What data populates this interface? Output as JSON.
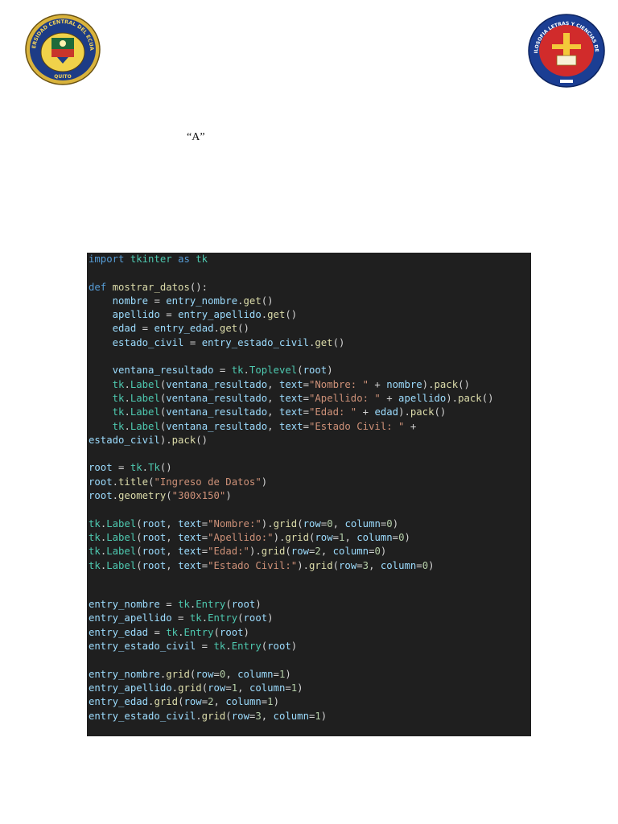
{
  "header": {
    "left_logo": "universidad-central-del-ecuador-seal",
    "right_logo": "facultad-de-filosofia-letras-y-ciencias-de-la-educacion-seal",
    "left_logo_text": "UNIVERSIDAD CENTRAL DEL ECUADOR",
    "left_logo_city": "QUITO",
    "right_logo_text": "FACULTAD DE FILOSOFIA LETRAS Y CIENCIAS DE LA EDUCACION"
  },
  "section_label": "“A”",
  "code": {
    "language": "python",
    "lines": [
      [
        [
          "kw",
          "import"
        ],
        [
          "plain",
          " "
        ],
        [
          "mod",
          "tkinter"
        ],
        [
          "plain",
          " "
        ],
        [
          "kw",
          "as"
        ],
        [
          "plain",
          " "
        ],
        [
          "mod",
          "tk"
        ]
      ],
      [],
      [
        [
          "kw",
          "def"
        ],
        [
          "plain",
          " "
        ],
        [
          "fn",
          "mostrar_datos"
        ],
        [
          "plain",
          "():"
        ]
      ],
      [
        [
          "plain",
          "    "
        ],
        [
          "var",
          "nombre"
        ],
        [
          "plain",
          " = "
        ],
        [
          "var",
          "entry_nombre"
        ],
        [
          "plain",
          "."
        ],
        [
          "fn",
          "get"
        ],
        [
          "plain",
          "()"
        ]
      ],
      [
        [
          "plain",
          "    "
        ],
        [
          "var",
          "apellido"
        ],
        [
          "plain",
          " = "
        ],
        [
          "var",
          "entry_apellido"
        ],
        [
          "plain",
          "."
        ],
        [
          "fn",
          "get"
        ],
        [
          "plain",
          "()"
        ]
      ],
      [
        [
          "plain",
          "    "
        ],
        [
          "var",
          "edad"
        ],
        [
          "plain",
          " = "
        ],
        [
          "var",
          "entry_edad"
        ],
        [
          "plain",
          "."
        ],
        [
          "fn",
          "get"
        ],
        [
          "plain",
          "()"
        ]
      ],
      [
        [
          "plain",
          "    "
        ],
        [
          "var",
          "estado_civil"
        ],
        [
          "plain",
          " = "
        ],
        [
          "var",
          "entry_estado_civil"
        ],
        [
          "plain",
          "."
        ],
        [
          "fn",
          "get"
        ],
        [
          "plain",
          "()"
        ]
      ],
      [],
      [
        [
          "plain",
          "    "
        ],
        [
          "var",
          "ventana_resultado"
        ],
        [
          "plain",
          " = "
        ],
        [
          "mod",
          "tk"
        ],
        [
          "plain",
          "."
        ],
        [
          "mod",
          "Toplevel"
        ],
        [
          "plain",
          "("
        ],
        [
          "var",
          "root"
        ],
        [
          "plain",
          ")"
        ]
      ],
      [
        [
          "plain",
          "    "
        ],
        [
          "mod",
          "tk"
        ],
        [
          "plain",
          "."
        ],
        [
          "mod",
          "Label"
        ],
        [
          "plain",
          "("
        ],
        [
          "var",
          "ventana_resultado"
        ],
        [
          "plain",
          ", "
        ],
        [
          "var",
          "text"
        ],
        [
          "plain",
          "="
        ],
        [
          "str",
          "\"Nombre: \""
        ],
        [
          "plain",
          " + "
        ],
        [
          "var",
          "nombre"
        ],
        [
          "plain",
          ")."
        ],
        [
          "fn",
          "pack"
        ],
        [
          "plain",
          "()"
        ]
      ],
      [
        [
          "plain",
          "    "
        ],
        [
          "mod",
          "tk"
        ],
        [
          "plain",
          "."
        ],
        [
          "mod",
          "Label"
        ],
        [
          "plain",
          "("
        ],
        [
          "var",
          "ventana_resultado"
        ],
        [
          "plain",
          ", "
        ],
        [
          "var",
          "text"
        ],
        [
          "plain",
          "="
        ],
        [
          "str",
          "\"Apellido: \""
        ],
        [
          "plain",
          " + "
        ],
        [
          "var",
          "apellido"
        ],
        [
          "plain",
          ")."
        ],
        [
          "fn",
          "pack"
        ],
        [
          "plain",
          "()"
        ]
      ],
      [
        [
          "plain",
          "    "
        ],
        [
          "mod",
          "tk"
        ],
        [
          "plain",
          "."
        ],
        [
          "mod",
          "Label"
        ],
        [
          "plain",
          "("
        ],
        [
          "var",
          "ventana_resultado"
        ],
        [
          "plain",
          ", "
        ],
        [
          "var",
          "text"
        ],
        [
          "plain",
          "="
        ],
        [
          "str",
          "\"Edad: \""
        ],
        [
          "plain",
          " + "
        ],
        [
          "var",
          "edad"
        ],
        [
          "plain",
          ")."
        ],
        [
          "fn",
          "pack"
        ],
        [
          "plain",
          "()"
        ]
      ],
      [
        [
          "plain",
          "    "
        ],
        [
          "mod",
          "tk"
        ],
        [
          "plain",
          "."
        ],
        [
          "mod",
          "Label"
        ],
        [
          "plain",
          "("
        ],
        [
          "var",
          "ventana_resultado"
        ],
        [
          "plain",
          ", "
        ],
        [
          "var",
          "text"
        ],
        [
          "plain",
          "="
        ],
        [
          "str",
          "\"Estado Civil: \""
        ],
        [
          "plain",
          " +"
        ]
      ],
      [
        [
          "var",
          "estado_civil"
        ],
        [
          "plain",
          ")."
        ],
        [
          "fn",
          "pack"
        ],
        [
          "plain",
          "()"
        ]
      ],
      [],
      [
        [
          "var",
          "root"
        ],
        [
          "plain",
          " = "
        ],
        [
          "mod",
          "tk"
        ],
        [
          "plain",
          "."
        ],
        [
          "mod",
          "Tk"
        ],
        [
          "plain",
          "()"
        ]
      ],
      [
        [
          "var",
          "root"
        ],
        [
          "plain",
          "."
        ],
        [
          "fn",
          "title"
        ],
        [
          "plain",
          "("
        ],
        [
          "str",
          "\"Ingreso de Datos\""
        ],
        [
          "plain",
          ")"
        ]
      ],
      [
        [
          "var",
          "root"
        ],
        [
          "plain",
          "."
        ],
        [
          "fn",
          "geometry"
        ],
        [
          "plain",
          "("
        ],
        [
          "str",
          "\"300x150\""
        ],
        [
          "plain",
          ")"
        ]
      ],
      [],
      [
        [
          "mod",
          "tk"
        ],
        [
          "plain",
          "."
        ],
        [
          "mod",
          "Label"
        ],
        [
          "plain",
          "("
        ],
        [
          "var",
          "root"
        ],
        [
          "plain",
          ", "
        ],
        [
          "var",
          "text"
        ],
        [
          "plain",
          "="
        ],
        [
          "str",
          "\"Nombre:\""
        ],
        [
          "plain",
          ")."
        ],
        [
          "fn",
          "grid"
        ],
        [
          "plain",
          "("
        ],
        [
          "var",
          "row"
        ],
        [
          "plain",
          "="
        ],
        [
          "num",
          "0"
        ],
        [
          "plain",
          ", "
        ],
        [
          "var",
          "column"
        ],
        [
          "plain",
          "="
        ],
        [
          "num",
          "0"
        ],
        [
          "plain",
          ")"
        ]
      ],
      [
        [
          "mod",
          "tk"
        ],
        [
          "plain",
          "."
        ],
        [
          "mod",
          "Label"
        ],
        [
          "plain",
          "("
        ],
        [
          "var",
          "root"
        ],
        [
          "plain",
          ", "
        ],
        [
          "var",
          "text"
        ],
        [
          "plain",
          "="
        ],
        [
          "str",
          "\"Apellido:\""
        ],
        [
          "plain",
          ")."
        ],
        [
          "fn",
          "grid"
        ],
        [
          "plain",
          "("
        ],
        [
          "var",
          "row"
        ],
        [
          "plain",
          "="
        ],
        [
          "num",
          "1"
        ],
        [
          "plain",
          ", "
        ],
        [
          "var",
          "column"
        ],
        [
          "plain",
          "="
        ],
        [
          "num",
          "0"
        ],
        [
          "plain",
          ")"
        ]
      ],
      [
        [
          "mod",
          "tk"
        ],
        [
          "plain",
          "."
        ],
        [
          "mod",
          "Label"
        ],
        [
          "plain",
          "("
        ],
        [
          "var",
          "root"
        ],
        [
          "plain",
          ", "
        ],
        [
          "var",
          "text"
        ],
        [
          "plain",
          "="
        ],
        [
          "str",
          "\"Edad:\""
        ],
        [
          "plain",
          ")."
        ],
        [
          "fn",
          "grid"
        ],
        [
          "plain",
          "("
        ],
        [
          "var",
          "row"
        ],
        [
          "plain",
          "="
        ],
        [
          "num",
          "2"
        ],
        [
          "plain",
          ", "
        ],
        [
          "var",
          "column"
        ],
        [
          "plain",
          "="
        ],
        [
          "num",
          "0"
        ],
        [
          "plain",
          ")"
        ]
      ],
      [
        [
          "mod",
          "tk"
        ],
        [
          "plain",
          "."
        ],
        [
          "mod",
          "Label"
        ],
        [
          "plain",
          "("
        ],
        [
          "var",
          "root"
        ],
        [
          "plain",
          ", "
        ],
        [
          "var",
          "text"
        ],
        [
          "plain",
          "="
        ],
        [
          "str",
          "\"Estado Civil:\""
        ],
        [
          "plain",
          ")."
        ],
        [
          "fn",
          "grid"
        ],
        [
          "plain",
          "("
        ],
        [
          "var",
          "row"
        ],
        [
          "plain",
          "="
        ],
        [
          "num",
          "3"
        ],
        [
          "plain",
          ", "
        ],
        [
          "var",
          "column"
        ],
        [
          "plain",
          "="
        ],
        [
          "num",
          "0"
        ],
        [
          "plain",
          ")"
        ]
      ],
      [],
      null,
      [
        [
          "var",
          "entry_nombre"
        ],
        [
          "plain",
          " = "
        ],
        [
          "mod",
          "tk"
        ],
        [
          "plain",
          "."
        ],
        [
          "mod",
          "Entry"
        ],
        [
          "plain",
          "("
        ],
        [
          "var",
          "root"
        ],
        [
          "plain",
          ")"
        ]
      ],
      [
        [
          "var",
          "entry_apellido"
        ],
        [
          "plain",
          " = "
        ],
        [
          "mod",
          "tk"
        ],
        [
          "plain",
          "."
        ],
        [
          "mod",
          "Entry"
        ],
        [
          "plain",
          "("
        ],
        [
          "var",
          "root"
        ],
        [
          "plain",
          ")"
        ]
      ],
      [
        [
          "var",
          "entry_edad"
        ],
        [
          "plain",
          " = "
        ],
        [
          "mod",
          "tk"
        ],
        [
          "plain",
          "."
        ],
        [
          "mod",
          "Entry"
        ],
        [
          "plain",
          "("
        ],
        [
          "var",
          "root"
        ],
        [
          "plain",
          ")"
        ]
      ],
      [
        [
          "var",
          "entry_estado_civil"
        ],
        [
          "plain",
          " = "
        ],
        [
          "mod",
          "tk"
        ],
        [
          "plain",
          "."
        ],
        [
          "mod",
          "Entry"
        ],
        [
          "plain",
          "("
        ],
        [
          "var",
          "root"
        ],
        [
          "plain",
          ")"
        ]
      ],
      [],
      [
        [
          "var",
          "entry_nombre"
        ],
        [
          "plain",
          "."
        ],
        [
          "fn",
          "grid"
        ],
        [
          "plain",
          "("
        ],
        [
          "var",
          "row"
        ],
        [
          "plain",
          "="
        ],
        [
          "num",
          "0"
        ],
        [
          "plain",
          ", "
        ],
        [
          "var",
          "column"
        ],
        [
          "plain",
          "="
        ],
        [
          "num",
          "1"
        ],
        [
          "plain",
          ")"
        ]
      ],
      [
        [
          "var",
          "entry_apellido"
        ],
        [
          "plain",
          "."
        ],
        [
          "fn",
          "grid"
        ],
        [
          "plain",
          "("
        ],
        [
          "var",
          "row"
        ],
        [
          "plain",
          "="
        ],
        [
          "num",
          "1"
        ],
        [
          "plain",
          ", "
        ],
        [
          "var",
          "column"
        ],
        [
          "plain",
          "="
        ],
        [
          "num",
          "1"
        ],
        [
          "plain",
          ")"
        ]
      ],
      [
        [
          "var",
          "entry_edad"
        ],
        [
          "plain",
          "."
        ],
        [
          "fn",
          "grid"
        ],
        [
          "plain",
          "("
        ],
        [
          "var",
          "row"
        ],
        [
          "plain",
          "="
        ],
        [
          "num",
          "2"
        ],
        [
          "plain",
          ", "
        ],
        [
          "var",
          "column"
        ],
        [
          "plain",
          "="
        ],
        [
          "num",
          "1"
        ],
        [
          "plain",
          ")"
        ]
      ],
      [
        [
          "var",
          "entry_estado_civil"
        ],
        [
          "plain",
          "."
        ],
        [
          "fn",
          "grid"
        ],
        [
          "plain",
          "("
        ],
        [
          "var",
          "row"
        ],
        [
          "plain",
          "="
        ],
        [
          "num",
          "3"
        ],
        [
          "plain",
          ", "
        ],
        [
          "var",
          "column"
        ],
        [
          "plain",
          "="
        ],
        [
          "num",
          "1"
        ],
        [
          "plain",
          ")"
        ]
      ]
    ]
  }
}
